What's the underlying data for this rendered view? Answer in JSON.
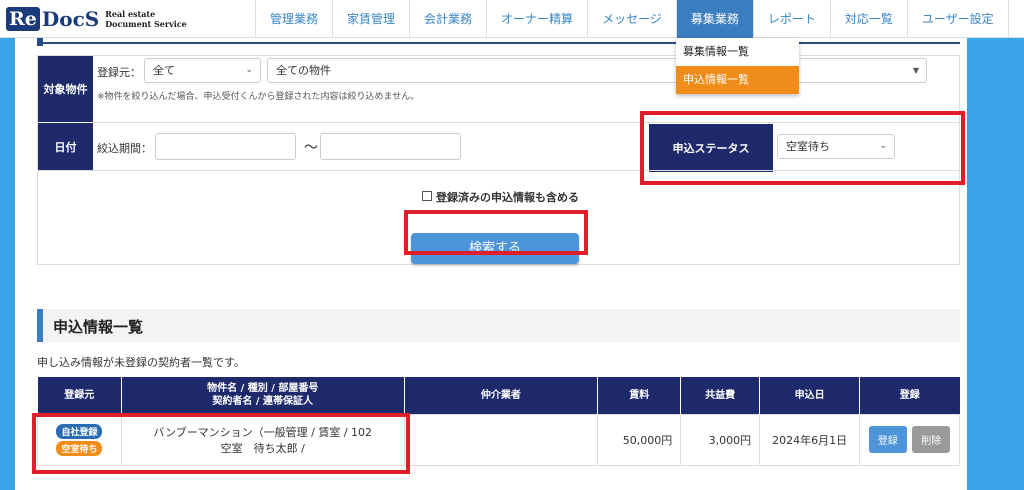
{
  "header": {
    "logo_re": "Re",
    "logo_docs": "DocS",
    "logo_sub1": "Real estate",
    "logo_sub2": "Document Service",
    "nav": [
      "管理業務",
      "家賃管理",
      "会計業務",
      "オーナー精算",
      "メッセージ",
      "募集業務",
      "レポート",
      "対応一覧",
      "ユーザー設定"
    ],
    "active_nav": "募集業務"
  },
  "dropdown": {
    "items": [
      "募集情報一覧",
      "申込情報一覧"
    ],
    "active": "申込情報一覧"
  },
  "filter": {
    "target_label": "対象物件",
    "source_label": "登録元：",
    "source_value": "全て",
    "property_value": "全ての物件",
    "note": "※物件を絞り込んだ場合、申込受付くんから登録された内容は絞り込めません。",
    "date_label": "日付",
    "period_label": "絞込期間：",
    "tilde": "〜",
    "status_label": "申込ステータス",
    "status_value": "空室待ち",
    "include_label": "登録済みの申込情報も含める",
    "search_button": "検索する"
  },
  "section": {
    "title": "申込情報一覧",
    "description": "申し込み情報が未登録の契約者一覧です。"
  },
  "table": {
    "headers": {
      "source": "登録元",
      "property_line1": "物件名 / 種別 / 部屋番号",
      "property_line2": "契約者名 / 連帯保証人",
      "agent": "仲介業者",
      "rent": "賃料",
      "common_fee": "共益費",
      "apply_date": "申込日",
      "register": "登録"
    },
    "rows": [
      {
        "badge1": "自社登録",
        "badge2": "空室待ち",
        "property_line1": "バンブーマンション（一般管理 / 賃室 / 102",
        "property_line2": "空室　待ち太郎 /",
        "agent": "",
        "rent": "50,000円",
        "common_fee": "3,000円",
        "apply_date": "2024年6月1日",
        "register_btn": "登録",
        "delete_btn": "削除"
      }
    ]
  },
  "colors": {
    "nav_active": "#3a7ec0",
    "header_navy": "#1e2a6b",
    "accent_orange": "#f08c1a",
    "highlight_red": "#e01e2a",
    "page_blue": "#3ba3e8"
  }
}
